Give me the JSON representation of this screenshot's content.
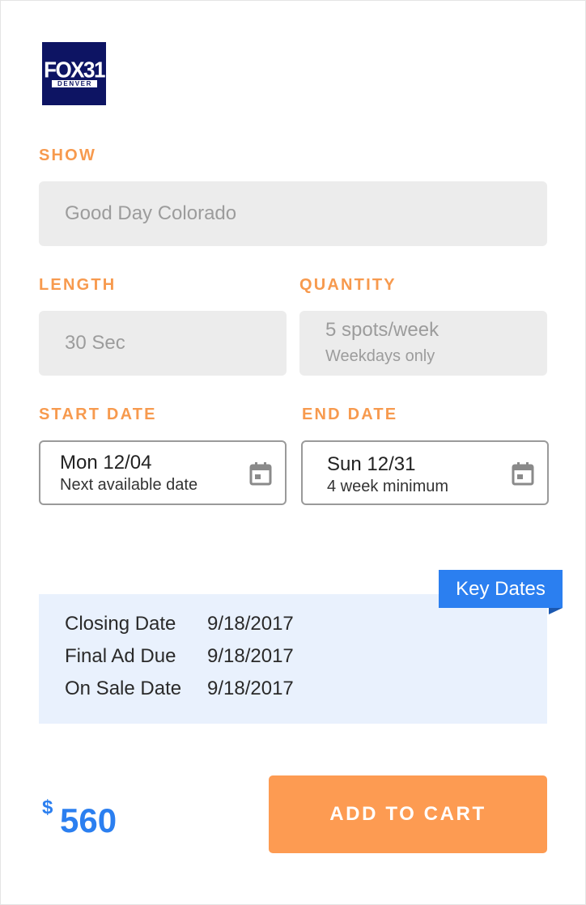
{
  "logo": {
    "text_main": "FOX31",
    "text_sub": "DENVER"
  },
  "form": {
    "show": {
      "label": "SHOW",
      "value": "Good Day Colorado"
    },
    "length": {
      "label": "LENGTH",
      "value": "30 Sec"
    },
    "quantity": {
      "label": "QUANTITY",
      "value": "5 spots/week",
      "note": "Weekdays only"
    },
    "start_date": {
      "label": "START DATE",
      "value": "Mon 12/04",
      "note": "Next available date",
      "icon": "calendar-icon"
    },
    "end_date": {
      "label": "END DATE",
      "value": "Sun 12/31",
      "note": "4 week minimum",
      "icon": "calendar-icon"
    }
  },
  "key_dates": {
    "badge": "Key Dates",
    "rows": [
      {
        "label": "Closing Date",
        "value": "9/18/2017"
      },
      {
        "label": "Final Ad Due",
        "value": "9/18/2017"
      },
      {
        "label": "On Sale Date",
        "value": "9/18/2017"
      }
    ]
  },
  "price": {
    "currency": "$",
    "amount": "560"
  },
  "add_to_cart": {
    "label": "ADD TO CART"
  },
  "colors": {
    "accent_orange": "#fd9b52",
    "label_orange": "#f79a4e",
    "accent_blue": "#2b7ff0",
    "logo_navy": "#0d1463",
    "key_dates_bg": "#e9f1fd"
  }
}
